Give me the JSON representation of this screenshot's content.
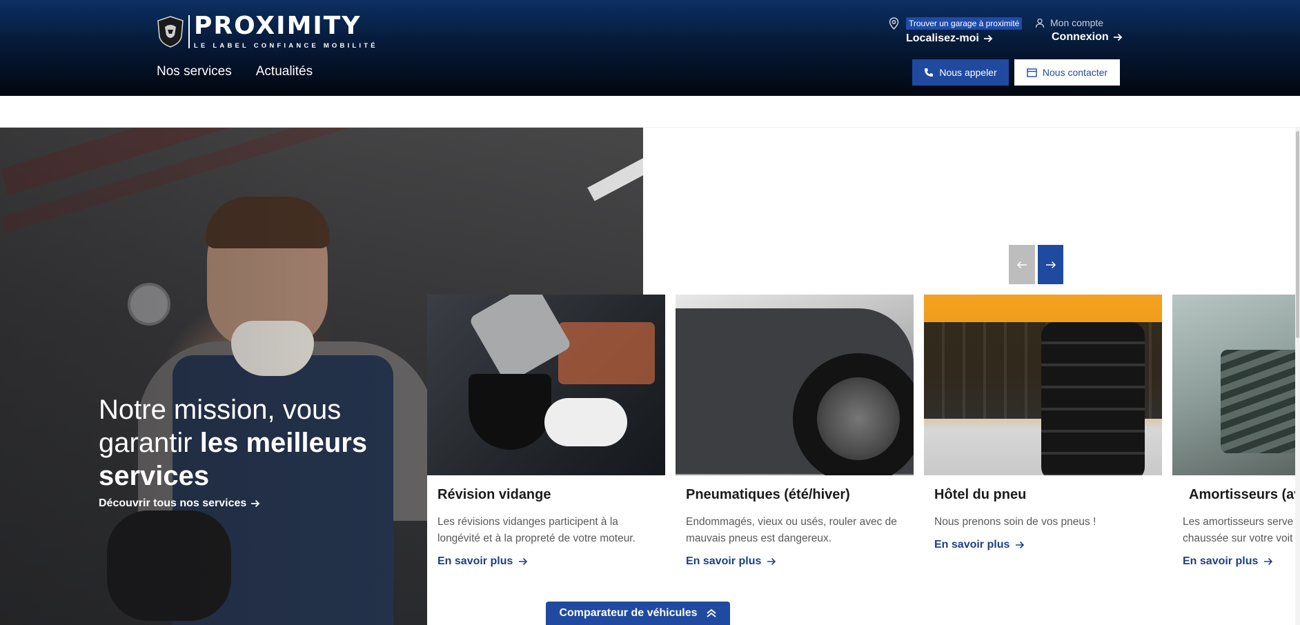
{
  "header": {
    "brand_name": "PROXIMITY",
    "brand_tagline": "LE LABEL CONFIANCE MOBILITÉ",
    "nav": [
      {
        "label": "Nos services"
      },
      {
        "label": "Actualités"
      }
    ],
    "locator": {
      "badge": "Trouver un garage à proximité",
      "link": "Localisez-moi"
    },
    "account": {
      "label": "Mon compte",
      "link": "Connexion"
    },
    "call_button": "Nous appeler",
    "contact_button": "Nous contacter"
  },
  "hero": {
    "title_plain": "Notre mission, vous garantir ",
    "title_bold": "les meilleurs services",
    "link": "Découvrir tous nos services"
  },
  "cards": [
    {
      "title": "Révision vidange",
      "description": "Les révisions vidanges participent à la longévité et à la propreté de votre moteur.",
      "link": "En savoir plus"
    },
    {
      "title": "Pneumatiques (été/hiver)",
      "description": "Endommagés, vieux ou usés, rouler avec de mauvais pneus est dangereux.",
      "link": "En savoir plus"
    },
    {
      "title": "Hôtel du pneu",
      "description": "Nous prenons soin de vos pneus !",
      "link": "En savoir plus"
    },
    {
      "title": "Amortisseurs (av",
      "description": "Les amortisseurs serve que peuvent avoir les d chaussée sur votre voit",
      "link": "En savoir plus"
    }
  ],
  "comparator": "Comparateur de véhicules",
  "colors": {
    "primary": "#1f4aa0",
    "header_dark": "#02070f",
    "link": "#1f3f85"
  }
}
